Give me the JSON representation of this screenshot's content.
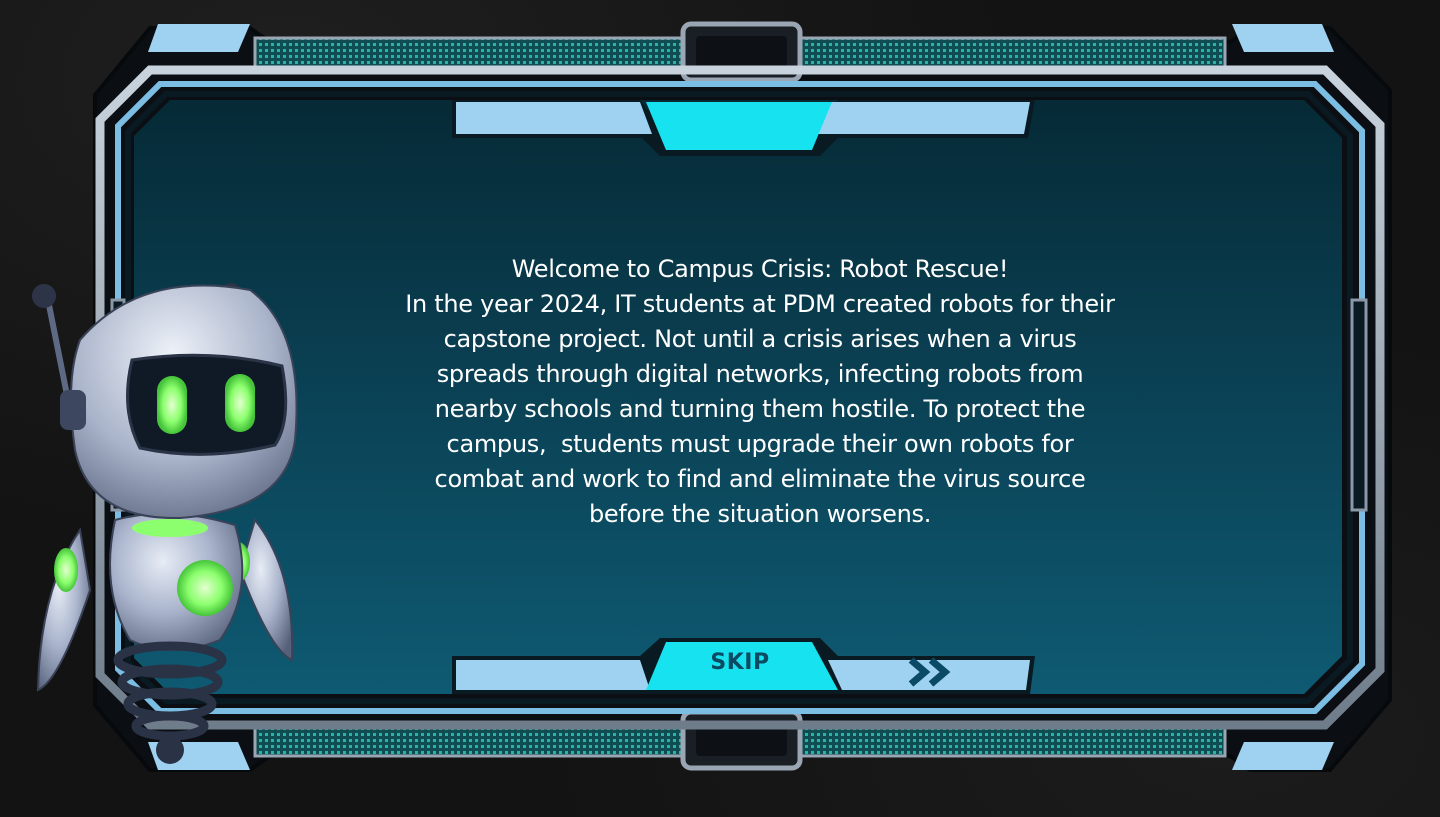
{
  "dialog": {
    "title": "Welcome to Campus Crisis: Robot Rescue!",
    "body_lines": [
      "In the year 2024, IT students at PDM created robots for their",
      "capstone project. Not until a crisis arises when a virus",
      "spreads through digital networks, infecting robots from",
      "nearby schools and turning them hostile. To protect the",
      "campus,  students must upgrade their own robots for",
      "combat and work to find and eliminate the virus source",
      "before the situation worsens."
    ]
  },
  "controls": {
    "skip_label": "SKIP",
    "next_icon": "double-chevron-right-icon"
  },
  "theme": {
    "background": "#131313",
    "panel_inner": "#0e4a5f",
    "frame_light": "#9fd2f0",
    "frame_cyan": "#17e3f0",
    "frame_steel": "#8a98a8",
    "text": "#ffffff",
    "robot_glow": "#7dff6b"
  }
}
